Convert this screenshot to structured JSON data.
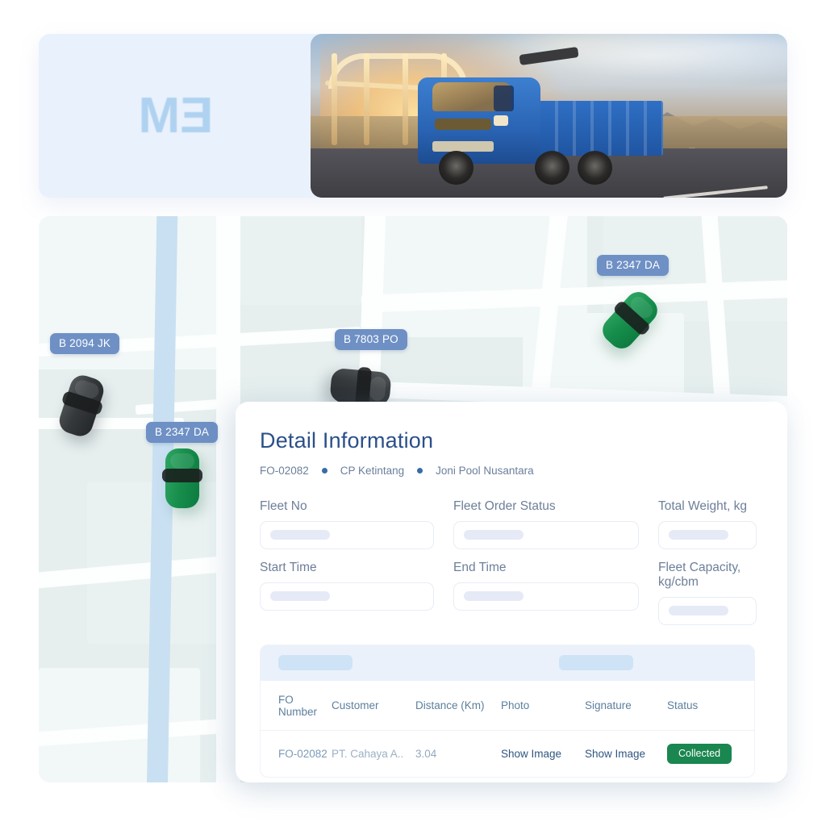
{
  "header": {
    "logo_text_main": "M",
    "logo_text_rev": "E",
    "hero_alt": "blue-dump-truck-on-highway-at-sunset"
  },
  "map": {
    "markers": [
      {
        "label": "B 2094 JK",
        "color": "dark"
      },
      {
        "label": "B 7803 PO",
        "color": "dark"
      },
      {
        "label": "B 2347 DA",
        "color": "green"
      },
      {
        "label": "B 2347 DA",
        "color": "green"
      }
    ],
    "colors": {
      "base": "#e6efee",
      "road": "#fdfefe",
      "river": "#c9e0f2",
      "marker": "#6e90c4"
    }
  },
  "detail": {
    "title": "Detail Information",
    "breadcrumb": [
      "FO-02082",
      "CP Ketintang",
      "Joni Pool Nusantara"
    ],
    "fields": [
      {
        "label": "Fleet No",
        "value": ""
      },
      {
        "label": "Fleet Order Status",
        "value": ""
      },
      {
        "label": "Total Weight, kg",
        "value": ""
      },
      {
        "label": "Start Time",
        "value": ""
      },
      {
        "label": "End Time",
        "value": ""
      },
      {
        "label": "Fleet Capacity, kg/cbm",
        "value": ""
      }
    ],
    "table": {
      "headers": [
        "FO Number",
        "Customer",
        "Distance (Km)",
        "Photo",
        "Signature",
        "Status"
      ],
      "rows": [
        {
          "fo_number": "FO-02082",
          "customer": "PT. Cahaya A..",
          "distance": "3.04",
          "photo": "Show Image",
          "signature": "Show Image",
          "status": "Collected",
          "status_color": "#1a8650"
        }
      ]
    }
  }
}
